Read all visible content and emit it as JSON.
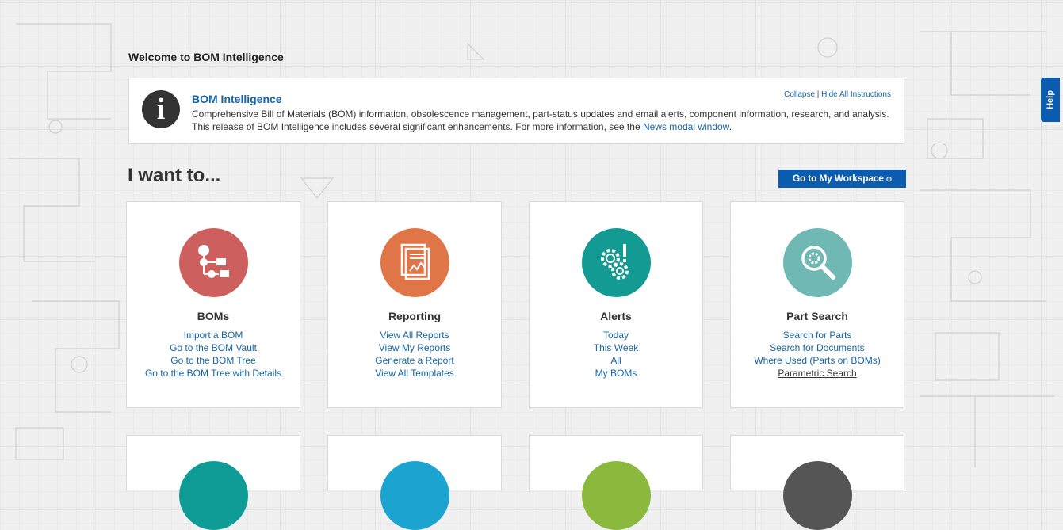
{
  "header": {
    "title": "Welcome to BOM Intelligence"
  },
  "info": {
    "title": "BOM Intelligence",
    "line1": "Comprehensive Bill of Materials (BOM) information, obsolescence management, part-status updates and email alerts, component information, research, and analysis.",
    "line2": "This release of BOM Intelligence includes several significant enhancements. For more information, see the",
    "news_link": "News modal window",
    "line2_end": ".",
    "collapse": "Collapse",
    "separator": " | ",
    "hide_all": "Hide All Instructions",
    "icon": "info-icon"
  },
  "help": {
    "label": "Help"
  },
  "iwant": {
    "heading": "I want to..."
  },
  "workspace": {
    "label": "Go to My Workspace",
    "arrow": "⊙"
  },
  "colors": {
    "accent": "#0b5cae",
    "link": "#1565a8",
    "boms": "#cd5f5f",
    "reporting": "#e07548",
    "alerts": "#139a93",
    "part_search": "#6fb8b3",
    "row2": [
      "#0f9c96",
      "#1ba4cf",
      "#8ab93d",
      "#555555"
    ]
  },
  "cards": [
    {
      "title": "BOMs",
      "icon": "bom-tree-icon",
      "links": [
        "Import a BOM",
        "Go to the BOM Vault",
        "Go to the BOM Tree",
        "Go to the BOM Tree with Details"
      ]
    },
    {
      "title": "Reporting",
      "icon": "report-icon",
      "links": [
        "View All Reports",
        "View My Reports",
        "Generate a Report",
        "View All Templates"
      ]
    },
    {
      "title": "Alerts",
      "icon": "alert-gears-icon",
      "links": [
        "Today",
        "This Week",
        "All",
        "My BOMs"
      ]
    },
    {
      "title": "Part Search",
      "icon": "part-search-icon",
      "links": [
        "Search for Parts",
        "Search for Documents",
        "Where Used (Parts on BOMs)",
        "Parametric Search"
      ]
    }
  ]
}
